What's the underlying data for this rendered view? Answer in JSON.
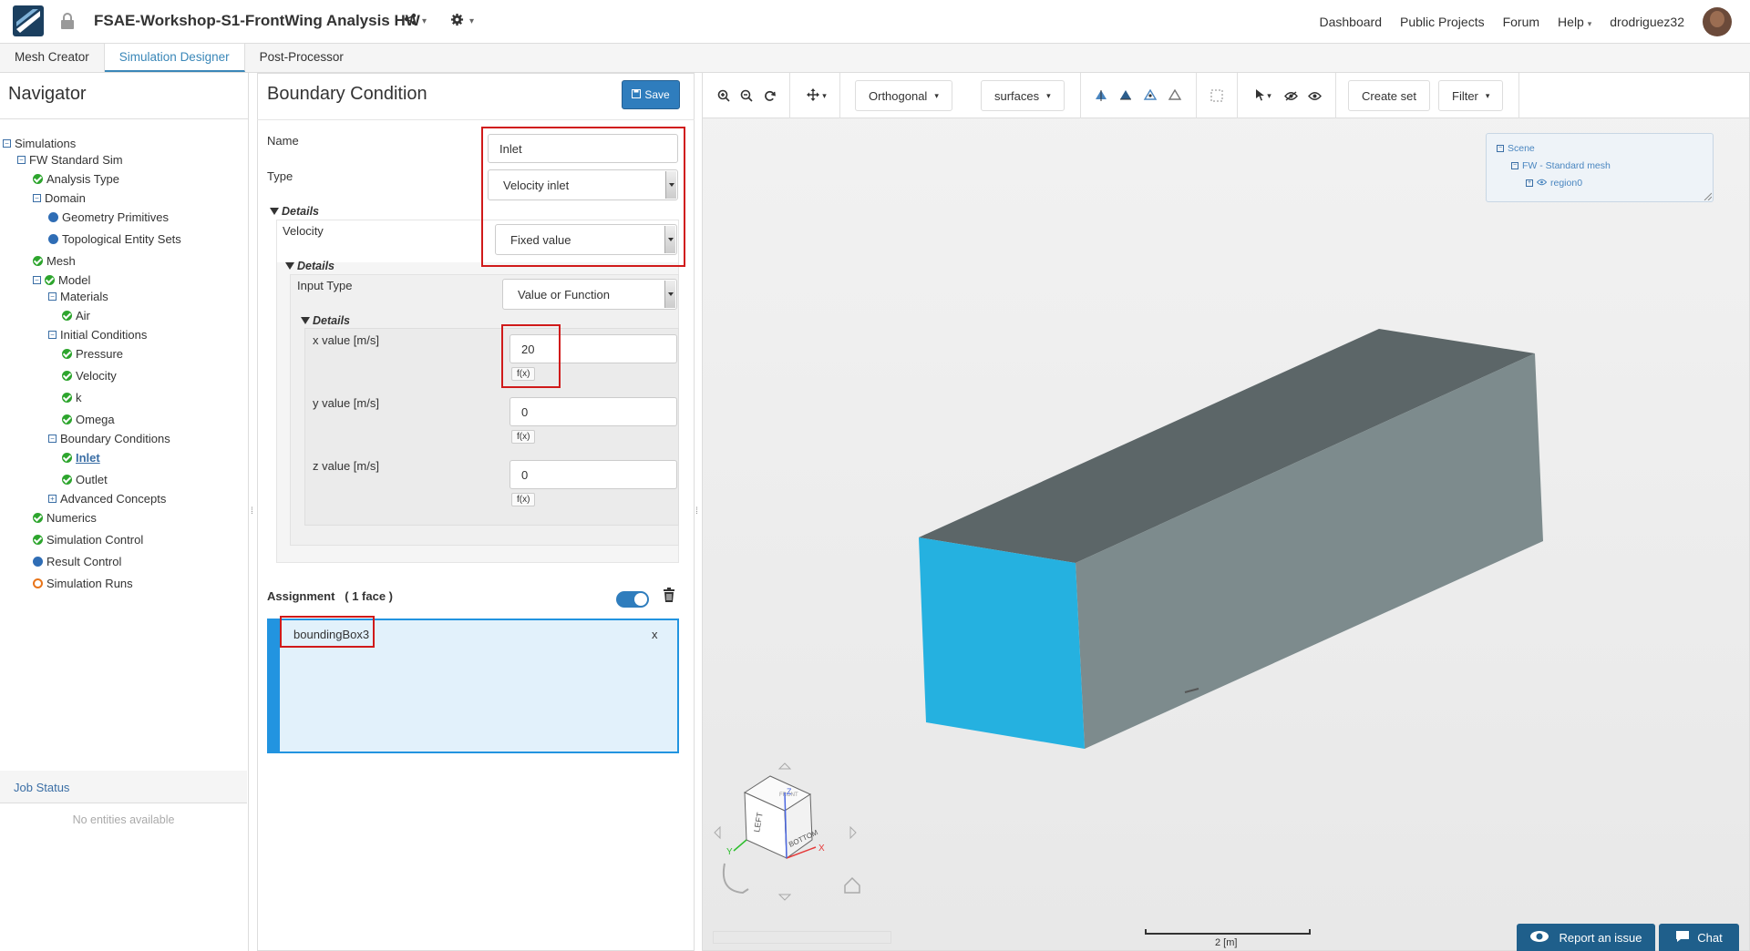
{
  "header": {
    "project_title": "FSAE-Workshop-S1-FrontWing Analysis HW",
    "nav": [
      "Dashboard",
      "Public Projects",
      "Forum",
      "Help",
      "drodriguez32"
    ]
  },
  "tabs": [
    "Mesh Creator",
    "Simulation Designer",
    "Post-Processor"
  ],
  "active_tab": "Simulation Designer",
  "navigator": {
    "title": "Navigator",
    "tree": [
      {
        "label": "Simulations",
        "status": "expander"
      },
      {
        "label": "FW Standard Sim",
        "status": "expander"
      },
      {
        "label": "Analysis Type",
        "status": "ok"
      },
      {
        "label": "Domain",
        "status": "expander"
      },
      {
        "label": "Geometry Primitives",
        "status": "blue"
      },
      {
        "label": "Topological Entity Sets",
        "status": "blue"
      },
      {
        "label": "Mesh",
        "status": "ok"
      },
      {
        "label": "Model",
        "status": "expander-ok"
      },
      {
        "label": "Materials",
        "status": "expander"
      },
      {
        "label": "Air",
        "status": "ok"
      },
      {
        "label": "Initial Conditions",
        "status": "expander"
      },
      {
        "label": "Pressure",
        "status": "ok"
      },
      {
        "label": "Velocity",
        "status": "ok"
      },
      {
        "label": "k",
        "status": "ok"
      },
      {
        "label": "Omega",
        "status": "ok"
      },
      {
        "label": "Boundary Conditions",
        "status": "expander"
      },
      {
        "label": "Inlet",
        "status": "ok"
      },
      {
        "label": "Outlet",
        "status": "ok"
      },
      {
        "label": "Advanced Concepts",
        "status": "expander-plus"
      },
      {
        "label": "Numerics",
        "status": "ok"
      },
      {
        "label": "Simulation Control",
        "status": "ok"
      },
      {
        "label": "Result Control",
        "status": "blue"
      },
      {
        "label": "Simulation Runs",
        "status": "empty"
      }
    ],
    "job_status_title": "Job Status",
    "job_status_empty": "No entities available"
  },
  "boundary_condition": {
    "title": "Boundary Condition",
    "save_label": "Save",
    "name_label": "Name",
    "name_value": "Inlet",
    "type_label": "Type",
    "type_value": "Velocity inlet",
    "details_label": "Details",
    "velocity_label": "Velocity",
    "velocity_value": "Fixed value",
    "input_type_label": "Input Type",
    "input_type_value": "Value or Function",
    "x_label": "x value [m/s]",
    "x_value": "20",
    "y_label": "y value [m/s]",
    "y_value": "0",
    "z_label": "z value [m/s]",
    "z_value": "0",
    "fx_label": "f(x)",
    "assignment_label": "Assignment",
    "assignment_count": "( 1 face )",
    "assigned_item": "boundingBox3",
    "remove_label": "x"
  },
  "viewer": {
    "projection": "Orthogonal",
    "render_mode": "surfaces",
    "create_set": "Create set",
    "filter": "Filter",
    "scene_tree": [
      "Scene",
      "FW - Standard mesh",
      "region0"
    ],
    "scale_label": "2 [m]",
    "cube_labels": [
      "LEFT",
      "BOTTOM",
      "FRONT"
    ],
    "axis_labels": [
      "X",
      "Y",
      "Z"
    ],
    "colors": {
      "selected_face": "#25b1e0",
      "box_top": "#5c6668",
      "box_side": "#7d8b8d"
    }
  },
  "footer": {
    "report_label": "Report an issue",
    "chat_label": "Chat"
  }
}
